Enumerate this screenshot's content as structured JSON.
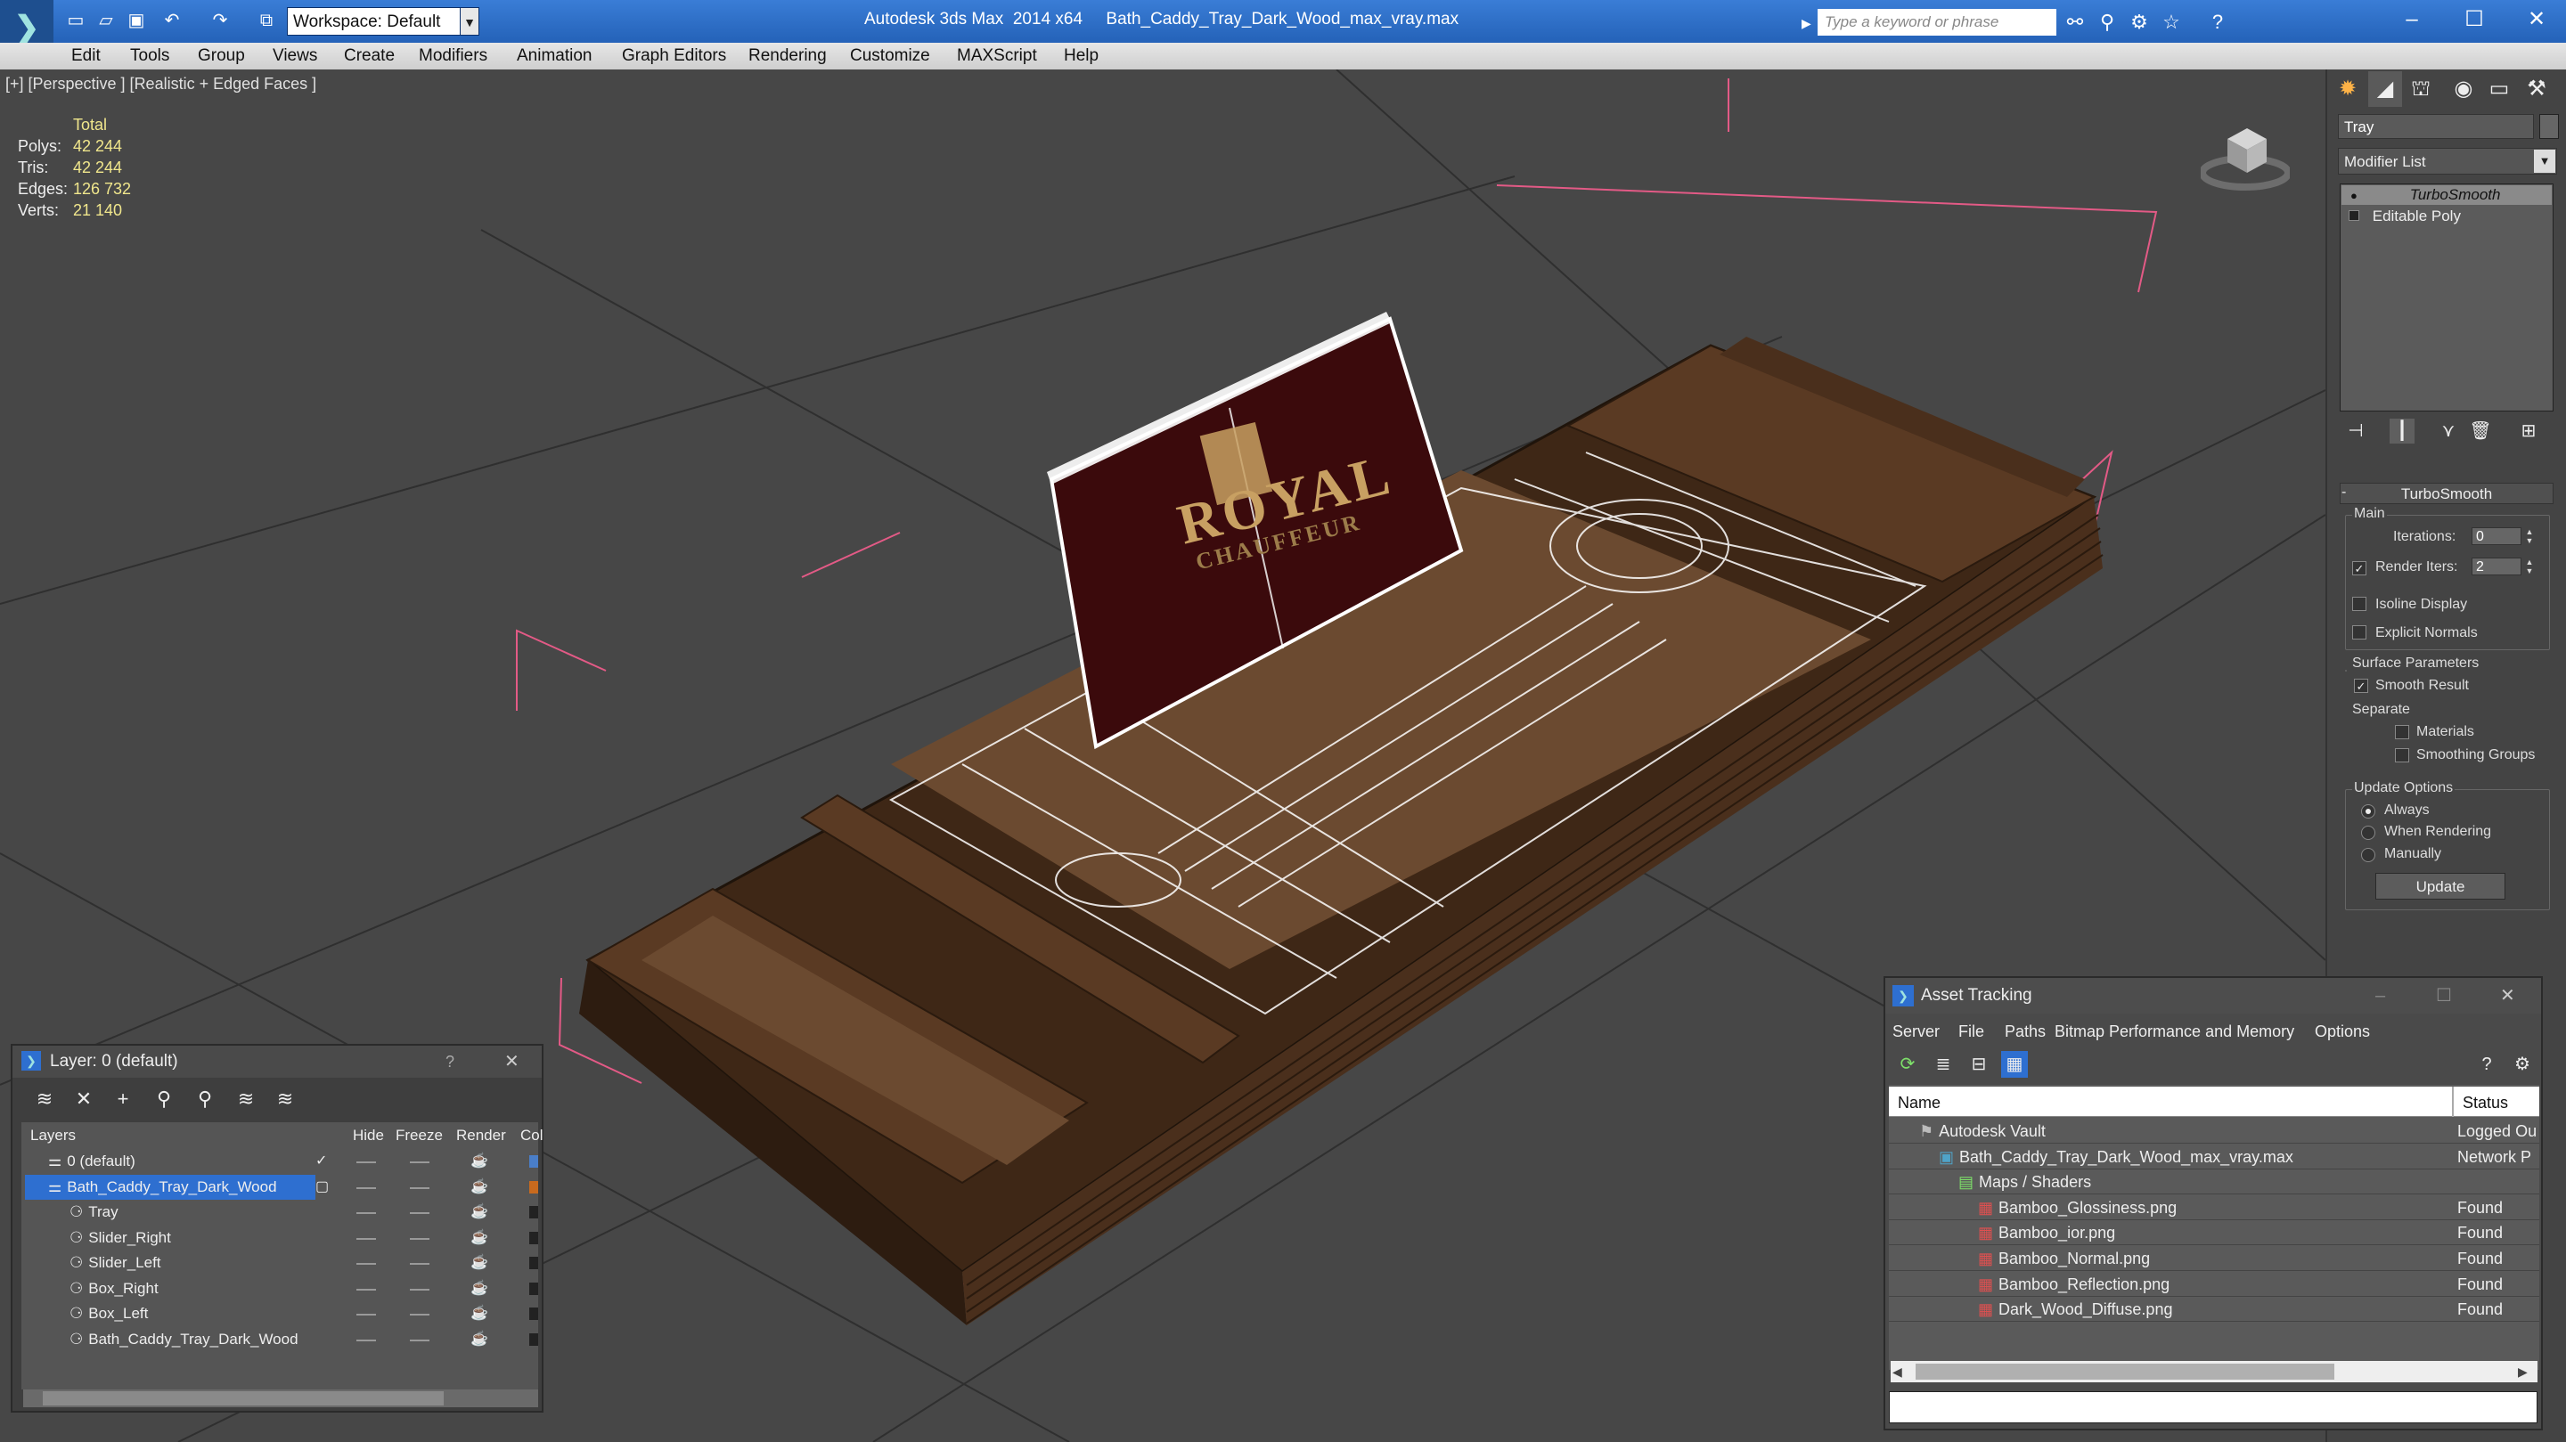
{
  "titlebar": {
    "workspace_label": "Workspace: Default",
    "app_title": "Autodesk 3ds Max  2014 x64     Bath_Caddy_Tray_Dark_Wood_max_vray.max",
    "search_placeholder": "Type a keyword or phrase"
  },
  "menu": [
    "Edit",
    "Tools",
    "Group",
    "Views",
    "Create",
    "Modifiers",
    "Animation",
    "Graph Editors",
    "Rendering",
    "Customize",
    "MAXScript",
    "Help"
  ],
  "viewport": {
    "label": "[+] [Perspective ] [Realistic + Edged Faces ]",
    "stats_header": "Total",
    "stats": [
      {
        "label": "Polys:",
        "value": "42 244"
      },
      {
        "label": "Tris:",
        "value": "42 244"
      },
      {
        "label": "Edges:",
        "value": "126 732"
      },
      {
        "label": "Verts:",
        "value": "21 140"
      }
    ],
    "sign_top_text": "ROYAL",
    "sign_bottom_text": "CHAUFFEUR"
  },
  "command_panel": {
    "object_name": "Tray",
    "modifier_list": "Modifier List",
    "stack": [
      {
        "label": "TurboSmooth",
        "active": true
      },
      {
        "label": "Editable Poly",
        "active": false
      }
    ],
    "turbosmooth": {
      "title": "TurboSmooth",
      "main_label": "Main",
      "iterations_label": "Iterations:",
      "iterations_value": "0",
      "render_iters_label": "Render Iters:",
      "render_iters_value": "2",
      "isoline_label": "Isoline Display",
      "explicit_normals_label": "Explicit Normals",
      "surface_params_label": "Surface Parameters",
      "smooth_result_label": "Smooth Result",
      "separate_label": "Separate",
      "materials_label": "Materials",
      "smoothing_groups_label": "Smoothing Groups",
      "update_options_label": "Update Options",
      "always_label": "Always",
      "when_rendering_label": "When Rendering",
      "manually_label": "Manually",
      "update_button": "Update"
    }
  },
  "layer_window": {
    "title": "Layer: 0 (default)",
    "help": "?",
    "columns": [
      "Layers",
      "Hide",
      "Freeze",
      "Render",
      "Col"
    ],
    "rows": [
      {
        "name": "0 (default)",
        "indent": 1,
        "selected": false,
        "swatch": "#4a7ec8",
        "check": "✓"
      },
      {
        "name": "Bath_Caddy_Tray_Dark_Wood",
        "indent": 1,
        "selected": true,
        "swatch": "#c86a1e",
        "check": "▢"
      },
      {
        "name": "Tray",
        "indent": 2,
        "selected": false,
        "swatch": "#222222",
        "check": ""
      },
      {
        "name": "Slider_Right",
        "indent": 2,
        "selected": false,
        "swatch": "#222222",
        "check": ""
      },
      {
        "name": "Slider_Left",
        "indent": 2,
        "selected": false,
        "swatch": "#222222",
        "check": ""
      },
      {
        "name": "Box_Right",
        "indent": 2,
        "selected": false,
        "swatch": "#222222",
        "check": ""
      },
      {
        "name": "Box_Left",
        "indent": 2,
        "selected": false,
        "swatch": "#222222",
        "check": ""
      },
      {
        "name": "Bath_Caddy_Tray_Dark_Wood",
        "indent": 2,
        "selected": false,
        "swatch": "#222222",
        "check": ""
      }
    ]
  },
  "asset_window": {
    "title": "Asset Tracking",
    "menu": [
      "Server",
      "File",
      "Paths",
      "Bitmap Performance and Memory",
      "Options"
    ],
    "columns": [
      "Name",
      "Status"
    ],
    "rows": [
      {
        "name": "Autodesk Vault",
        "indent": 1,
        "status": "Logged Ou"
      },
      {
        "name": "Bath_Caddy_Tray_Dark_Wood_max_vray.max",
        "indent": 2,
        "status": "Network P"
      },
      {
        "name": "Maps / Shaders",
        "indent": 3,
        "status": ""
      },
      {
        "name": "Bamboo_Glossiness.png",
        "indent": 4,
        "status": "Found"
      },
      {
        "name": "Bamboo_ior.png",
        "indent": 4,
        "status": "Found"
      },
      {
        "name": "Bamboo_Normal.png",
        "indent": 4,
        "status": "Found"
      },
      {
        "name": "Bamboo_Reflection.png",
        "indent": 4,
        "status": "Found"
      },
      {
        "name": "Dark_Wood_Diffuse.png",
        "indent": 4,
        "status": "Found"
      }
    ]
  },
  "colors": {
    "titlebar": "#2a6bc4",
    "viewport_bg": "#474747",
    "selection": "#2e6fd0",
    "wood_dark": "#4a2f1c",
    "wood_light": "#6b4a30",
    "sign": "#3b0a0c"
  }
}
